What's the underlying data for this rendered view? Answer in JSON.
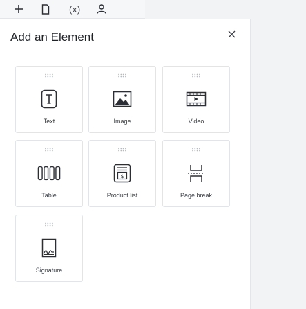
{
  "toolbar": {
    "items": [
      {
        "icon": "plus-icon"
      },
      {
        "icon": "page-icon"
      },
      {
        "icon": "variable-icon",
        "text": "(x)"
      },
      {
        "icon": "person-icon"
      }
    ]
  },
  "panel": {
    "title": "Add an Element",
    "close_icon": "close-icon"
  },
  "elements": [
    {
      "label": "Text",
      "icon": "text-icon"
    },
    {
      "label": "Image",
      "icon": "image-icon"
    },
    {
      "label": "Video",
      "icon": "video-icon"
    },
    {
      "label": "Table",
      "icon": "table-icon"
    },
    {
      "label": "Product list",
      "icon": "product-list-icon"
    },
    {
      "label": "Page break",
      "icon": "page-break-icon"
    },
    {
      "label": "Signature",
      "icon": "signature-icon"
    }
  ],
  "colors": {
    "panel_bg": "#ffffff",
    "page_bg": "#f1f3f5",
    "border": "#e1e4e8",
    "text": "#1f2328",
    "icon": "#2b2f35"
  }
}
